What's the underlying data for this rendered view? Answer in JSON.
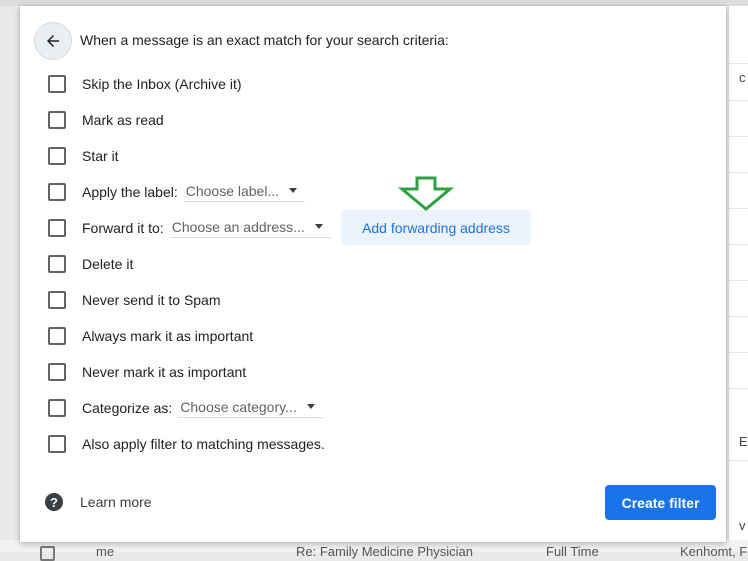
{
  "header": {
    "description": "When a message is an exact match for your search criteria:"
  },
  "options": [
    {
      "label": "Skip the Inbox (Archive it)"
    },
    {
      "label": "Mark as read"
    },
    {
      "label": "Star it"
    },
    {
      "label": "Apply the label:",
      "select": "Choose label..."
    },
    {
      "label": "Forward it to:",
      "select": "Choose an address..."
    },
    {
      "label": "Delete it"
    },
    {
      "label": "Never send it to Spam"
    },
    {
      "label": "Always mark it as important"
    },
    {
      "label": "Never mark it as important"
    },
    {
      "label": "Categorize as:",
      "select": "Choose category..."
    },
    {
      "label": "Also apply filter to matching messages."
    }
  ],
  "forwarding": {
    "add_label": "Add forwarding address"
  },
  "footer": {
    "help_glyph": "?",
    "learn_more": "Learn more",
    "create_label": "Create filter"
  },
  "background": {
    "right_fragments": [
      "c",
      "E",
      "v"
    ],
    "row_cells": [
      "me",
      "Re: Family Medicine Physician",
      "Full Time",
      "Kenhomt, F"
    ]
  },
  "colors": {
    "primary": "#1a73e8",
    "forward_button_bg": "#edf3fc",
    "annotation_arrow": "#2ea043"
  },
  "icons": {
    "back": "arrow-left-icon",
    "help": "help-circle-icon",
    "annotation": "down-arrow-outline-icon"
  }
}
